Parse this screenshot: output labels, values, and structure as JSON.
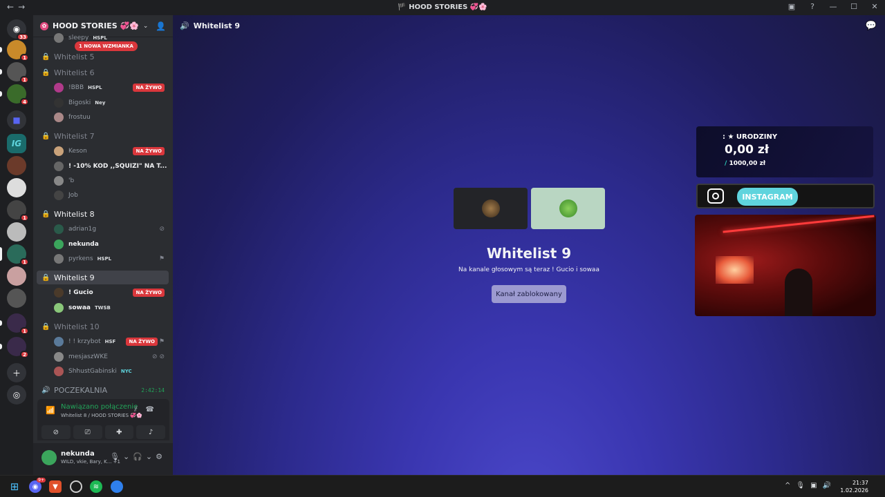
{
  "window": {
    "title": "🏴 HOOD STORIES 💞🌸",
    "back": "←",
    "forward": "→"
  },
  "guild": {
    "name": "HOOD STORIES 💞🌸",
    "mention_badge": "1 NOWA WZMIANKA"
  },
  "channels": [
    {
      "name": "Whitelist 5"
    },
    {
      "name": "Whitelist 6"
    },
    {
      "name": "Whitelist 7"
    },
    {
      "name": "Whitelist 8"
    },
    {
      "name": "Whitelist 9"
    },
    {
      "name": "Whitelist 10"
    },
    {
      "name": "POCZEKALNIA",
      "time": "2:42:14"
    }
  ],
  "members": {
    "partial": {
      "name": "sleepy",
      "tag": "HSPL"
    },
    "wl6": [
      {
        "name": "!BBB",
        "tag": "HSPL",
        "live": "NA ŻYWO"
      },
      {
        "name": "Bigoski",
        "tag": "Ney"
      },
      {
        "name": "frostuu"
      }
    ],
    "wl7": [
      {
        "name": "Keson",
        "live": "NA ŻYWO"
      },
      {
        "name": "! -10% KOD ,,SQUIZI\" NA T..."
      },
      {
        "name": "'b"
      },
      {
        "name": "Job"
      }
    ],
    "wl8": [
      {
        "name": "adrian1g"
      },
      {
        "name": "nekunda"
      },
      {
        "name": "pyrkens",
        "tag": "HSPL"
      }
    ],
    "wl9": [
      {
        "name": "! Gucio",
        "live": "NA ŻYWO"
      },
      {
        "name": "sowaa",
        "tag": "TWSB"
      }
    ],
    "wl10": [
      {
        "name": "! ! krzybot",
        "tag": "HSF",
        "live": "NA ŻYWO"
      },
      {
        "name": "mesjaszWKE"
      },
      {
        "name": "ShhustGabinski",
        "tag": "NYC"
      }
    ]
  },
  "voice": {
    "status": "Nawiązano połączenie",
    "location": "Whitelist 8 / HOOD STORIES 💞🌸"
  },
  "user": {
    "name": "nekunda",
    "status": "WILD, vkie, Bary, K... +1"
  },
  "main": {
    "channel_title": "Whitelist 9",
    "heading": "Whitelist 9",
    "subtitle": "Na kanale głosowym są teraz ! Gucio i sowaa",
    "button": "Kanał zablokowany"
  },
  "overlay": {
    "birthday_title": ": ★ URODZINY",
    "amount": "0,00 zł",
    "goal_slash": "/",
    "goal": "1000,00 zł",
    "instagram": "INSTAGRAM"
  },
  "server_badges": [
    "33",
    "1",
    "1",
    "4",
    "1",
    "1",
    "1",
    "1",
    "2"
  ],
  "taskbar": {
    "time": "21:37",
    "date": "1.02.2026",
    "discord_badge": "9+"
  },
  "colors": {
    "live": "#da373c",
    "connected": "#23a55a",
    "accent": "#5865f2"
  }
}
